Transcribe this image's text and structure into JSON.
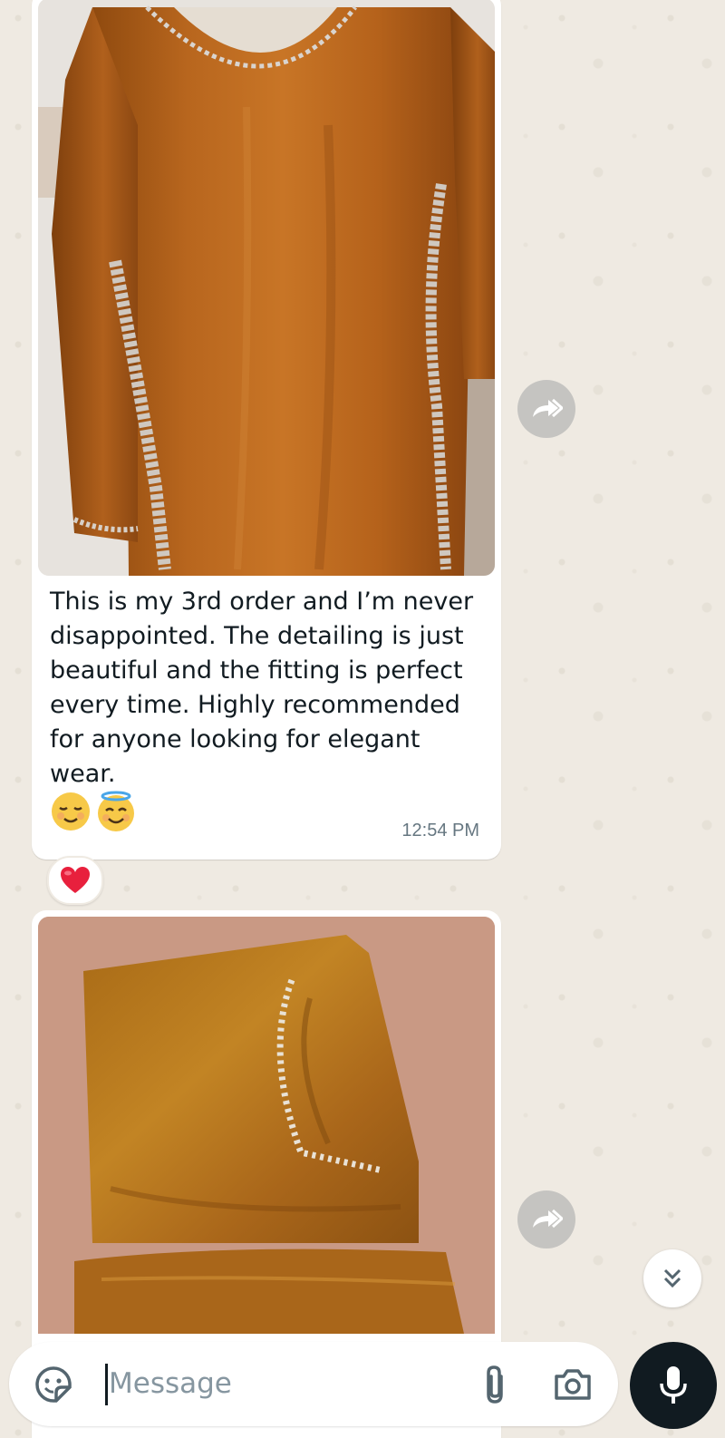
{
  "messages": [
    {
      "image": "garment-hanging-photo",
      "caption": "This is my 3rd order and I’m never disappointed. The detailing is just beautiful and the fitting is perfect every time. Highly recommended for anyone looking for elegant wear.",
      "emojis": [
        "relieved-face-emoji",
        "smiling-face-with-halo-emoji"
      ],
      "time": "12:54 PM",
      "reaction": "red-heart-emoji"
    },
    {
      "image": "garment-folded-photo"
    }
  ],
  "composer": {
    "placeholder": "Message",
    "value": ""
  },
  "icons": {
    "forward": "forward-icon",
    "scroll_down": "chevron-double-down-icon",
    "sticker": "sticker-icon",
    "attach": "paperclip-icon",
    "camera": "camera-icon",
    "mic": "microphone-icon"
  },
  "colors": {
    "wallpaper": "#efeae2",
    "bubble": "#ffffff",
    "fabric": "#b5641c",
    "timestamp": "#667781",
    "mic_button": "#111b21"
  }
}
